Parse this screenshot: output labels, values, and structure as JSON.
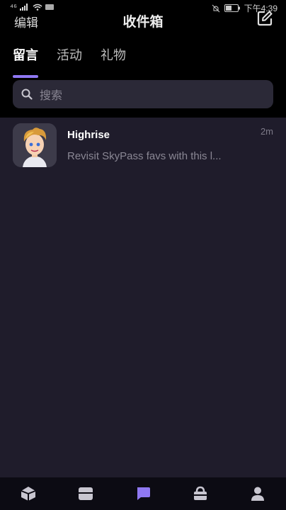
{
  "statusbar": {
    "signal_label": "⁴⁶",
    "time": "下午4:39"
  },
  "header": {
    "left_action": "编辑",
    "title": "收件箱",
    "right_icon": "compose-icon"
  },
  "tabs": [
    {
      "label": "留言",
      "active": true
    },
    {
      "label": "活动",
      "active": false
    },
    {
      "label": "礼物",
      "active": false
    }
  ],
  "search": {
    "placeholder": "搜索"
  },
  "messages": [
    {
      "sender": "Highrise",
      "preview": "Revisit SkyPass favs with this l...",
      "time": "2m"
    }
  ],
  "bottom_nav": [
    {
      "icon": "home-icon"
    },
    {
      "icon": "feed-icon"
    },
    {
      "icon": "chat-icon",
      "active": true
    },
    {
      "icon": "shop-icon"
    },
    {
      "icon": "profile-icon"
    }
  ],
  "colors": {
    "accent": "#8f78f2",
    "background": "#1f1c2b",
    "header": "#000000"
  }
}
